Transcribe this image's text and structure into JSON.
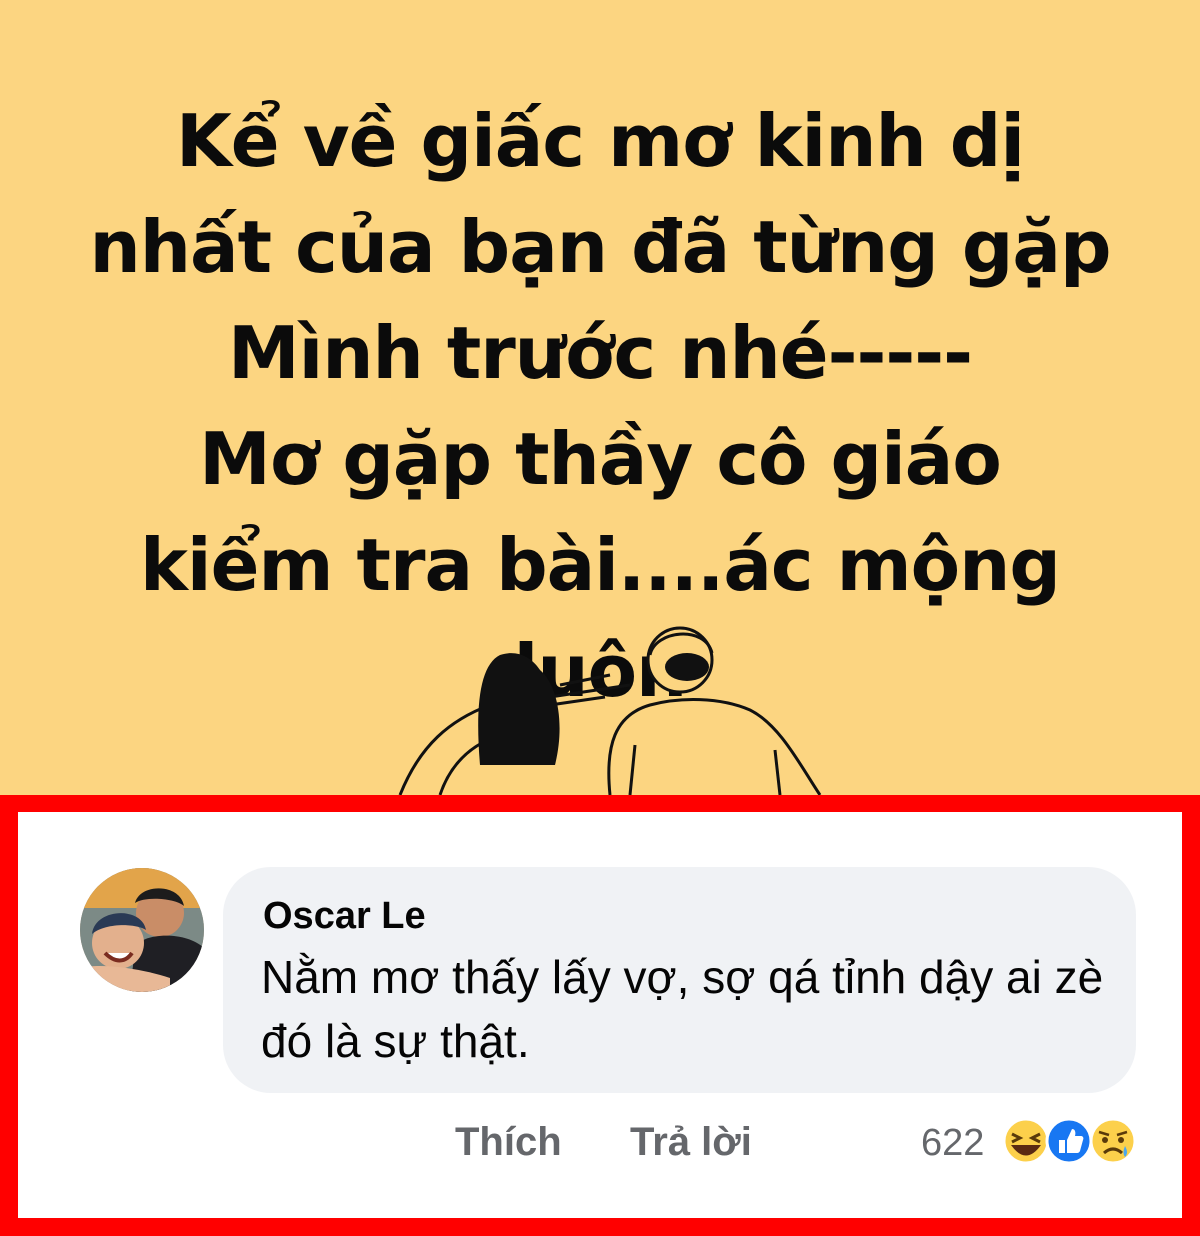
{
  "post": {
    "background_color": "#fcd581",
    "lines": [
      "Kể về giấc mơ kinh dị",
      "nhất của bạn đã từng gặp",
      "Mình trước nhé-----",
      "Mơ gặp thầy cô giáo",
      "kiểm tra bài....ác mộng",
      "luôn"
    ]
  },
  "comment": {
    "author": "Oscar Le",
    "text": "Nằm mơ thấy lấy vợ, sợ qá tỉnh dậy ai zè đó là sự thật.",
    "actions": {
      "like_label": "Thích",
      "reply_label": "Trả lời"
    },
    "reaction_count": "622",
    "reactions": [
      "haha-icon",
      "like-icon",
      "sad-icon"
    ]
  },
  "highlight_color": "#ff0000"
}
